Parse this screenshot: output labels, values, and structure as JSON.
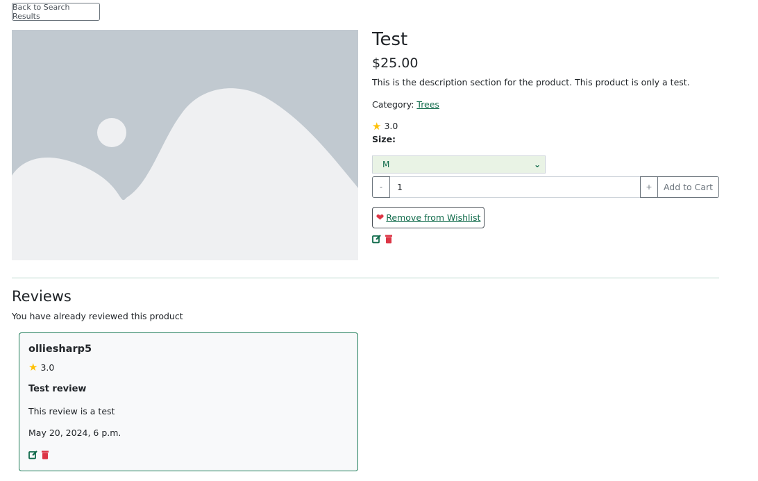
{
  "nav": {
    "back_label": "Back to Search Results"
  },
  "product": {
    "title": "Test",
    "price": "$25.00",
    "description": "This is the description section for the product. This product is only a test.",
    "category_label": "Category:",
    "category_link": "Trees",
    "rating": "3.0",
    "size_label": "Size:",
    "size_selected": "M",
    "quantity": "1",
    "minus_label": "-",
    "plus_label": "+",
    "add_to_cart_label": "Add to Cart",
    "wishlist_label": "Remove from Wishlist"
  },
  "reviews": {
    "heading": "Reviews",
    "notice": "You have already reviewed this product",
    "items": [
      {
        "author": "olliesharp5",
        "rating": "3.0",
        "title": "Test review",
        "body": "This review is a test",
        "date": "May 20, 2024, 6 p.m."
      }
    ]
  },
  "colors": {
    "accent_green": "#0f6a4a",
    "danger_red": "#dc3545",
    "star_yellow": "#ffc107",
    "placeholder_bg": "#c1c9d0"
  }
}
